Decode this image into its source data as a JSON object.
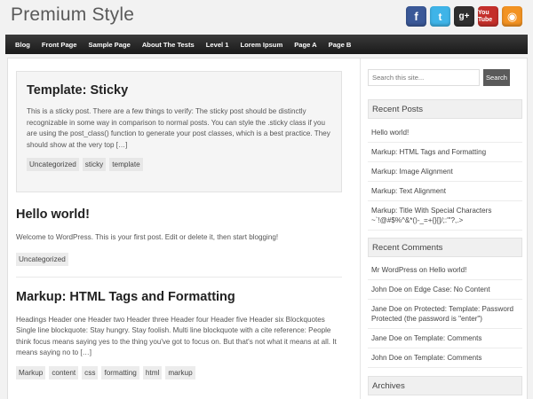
{
  "header": {
    "site_title": "Premium Style",
    "social": [
      {
        "name": "facebook-icon",
        "glyph": "f"
      },
      {
        "name": "twitter-icon",
        "glyph": "t"
      },
      {
        "name": "google-plus-icon",
        "glyph": "g+"
      },
      {
        "name": "youtube-icon",
        "glyph": "You Tube"
      },
      {
        "name": "rss-icon",
        "glyph": "◉"
      }
    ]
  },
  "nav": {
    "items": [
      "Blog",
      "Front Page",
      "Sample Page",
      "About The Tests",
      "Level 1",
      "Lorem Ipsum",
      "Page A",
      "Page B"
    ]
  },
  "posts": [
    {
      "title": "Template: Sticky",
      "excerpt": "This is a sticky post. There are a few things to verify: The sticky post should be distinctly recognizable in some way in comparison to normal posts. You can style the .sticky class if you are using the post_class() function to generate your post classes, which is a best practice. They should show at the very top […]",
      "tags": [
        "Uncategorized",
        "sticky",
        "template"
      ]
    },
    {
      "title": "Hello world!",
      "excerpt": "Welcome to WordPress. This is your first post. Edit or delete it, then start blogging!",
      "tags": [
        "Uncategorized"
      ]
    },
    {
      "title": "Markup: HTML Tags and Formatting",
      "excerpt": "Headings Header one Header two Header three Header four Header five Header six Blockquotes Single line blockquote: Stay hungry. Stay foolish. Multi line blockquote with a cite reference: People think focus means saying yes to the thing you've got to focus on. But that's not what it means at all. It means saying no to […]",
      "tags": [
        "Markup",
        "content",
        "css",
        "formatting",
        "html",
        "markup"
      ]
    }
  ],
  "sidebar": {
    "search": {
      "placeholder": "Search this site...",
      "button": "Search"
    },
    "recent_posts": {
      "title": "Recent Posts",
      "items": [
        "Hello world!",
        "Markup: HTML Tags and Formatting",
        "Markup: Image Alignment",
        "Markup: Text Alignment",
        "Markup: Title With Special Characters ~`!@#$%^&*()-_=+{}[]/;:'\"?,.>"
      ]
    },
    "recent_comments": {
      "title": "Recent Comments",
      "items": [
        "Mr WordPress on Hello world!",
        "John Doe on Edge Case: No Content",
        "Jane Doe on Protected: Template: Password Protected (the password is \"enter\")",
        "Jane Doe on Template: Comments",
        "John Doe on Template: Comments"
      ]
    },
    "archives": {
      "title": "Archives"
    }
  }
}
